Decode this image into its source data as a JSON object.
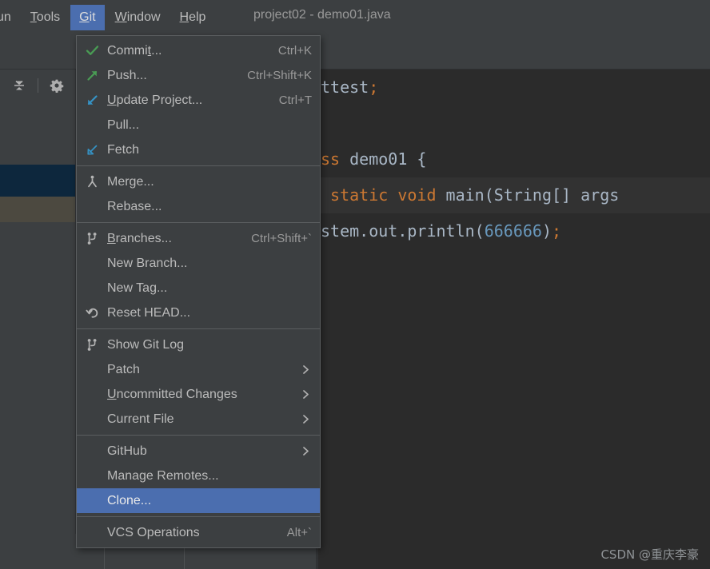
{
  "window": {
    "title": "project02 - demo01.java"
  },
  "menubar": {
    "items": [
      {
        "label": "un",
        "mnemonic": "",
        "active": false
      },
      {
        "label": "Tools",
        "mnemonic": "T",
        "active": false
      },
      {
        "label": "Git",
        "mnemonic": "G",
        "active": true
      },
      {
        "label": "Window",
        "mnemonic": "W",
        "active": false
      },
      {
        "label": "Help",
        "mnemonic": "H",
        "active": false
      }
    ]
  },
  "toolbar": {
    "icons": [
      {
        "name": "collapse-all-icon"
      },
      {
        "name": "gear-icon"
      }
    ]
  },
  "git_menu": {
    "selected_item": "Clone...",
    "highlight_color": "#4b6eaf",
    "background_color": "#3c3f41",
    "groups": [
      {
        "items": [
          {
            "label": "Commit...",
            "accel": "Ctrl+K",
            "icon": "commit-check-icon",
            "mnemonic": "t",
            "arrow": false
          },
          {
            "label": "Push...",
            "accel": "Ctrl+Shift+K",
            "icon": "push-arrow-icon",
            "mnemonic": "",
            "arrow": false
          },
          {
            "label": "Update Project...",
            "accel": "Ctrl+T",
            "icon": "update-arrow-icon",
            "mnemonic": "U",
            "arrow": false
          },
          {
            "label": "Pull...",
            "accel": "",
            "icon": "",
            "mnemonic": "",
            "arrow": false
          },
          {
            "label": "Fetch",
            "accel": "",
            "icon": "fetch-arrow-icon",
            "mnemonic": "",
            "arrow": false
          }
        ]
      },
      {
        "items": [
          {
            "label": "Merge...",
            "accel": "",
            "icon": "merge-icon",
            "mnemonic": "",
            "arrow": false
          },
          {
            "label": "Rebase...",
            "accel": "",
            "icon": "",
            "mnemonic": "",
            "arrow": false
          }
        ]
      },
      {
        "items": [
          {
            "label": "Branches...",
            "accel": "Ctrl+Shift+`",
            "icon": "branch-icon",
            "mnemonic": "B",
            "arrow": false
          },
          {
            "label": "New Branch...",
            "accel": "",
            "icon": "",
            "mnemonic": "",
            "arrow": false
          },
          {
            "label": "New Tag...",
            "accel": "",
            "icon": "",
            "mnemonic": "",
            "arrow": false
          },
          {
            "label": "Reset HEAD...",
            "accel": "",
            "icon": "reset-undo-icon",
            "mnemonic": "",
            "arrow": false
          }
        ]
      },
      {
        "items": [
          {
            "label": "Show Git Log",
            "accel": "",
            "icon": "git-log-branch-icon",
            "mnemonic": "",
            "arrow": false
          },
          {
            "label": "Patch",
            "accel": "",
            "icon": "",
            "mnemonic": "",
            "arrow": true
          },
          {
            "label": "Uncommitted Changes",
            "accel": "",
            "icon": "",
            "mnemonic": "U",
            "arrow": true
          },
          {
            "label": "Current File",
            "accel": "",
            "icon": "",
            "mnemonic": "",
            "arrow": true
          }
        ]
      },
      {
        "items": [
          {
            "label": "GitHub",
            "accel": "",
            "icon": "",
            "mnemonic": "",
            "arrow": true
          },
          {
            "label": "Manage Remotes...",
            "accel": "",
            "icon": "",
            "mnemonic": "",
            "arrow": false
          },
          {
            "label": "Clone...",
            "accel": "",
            "icon": "",
            "mnemonic": "",
            "arrow": false,
            "selected": true
          }
        ]
      },
      {
        "items": [
          {
            "label": "VCS Operations",
            "accel": "Alt+`",
            "icon": "",
            "mnemonic": "",
            "arrow": false
          }
        ]
      }
    ]
  },
  "editor": {
    "background_color": "#2b2b2b",
    "lines": [
      {
        "highlight": false,
        "tokens": [
          {
            "t": "ttest",
            "c": "pn"
          },
          {
            "t": ";",
            "c": "kw"
          }
        ]
      },
      {
        "highlight": false,
        "tokens": []
      },
      {
        "highlight": false,
        "tokens": [
          {
            "t": "ss ",
            "c": "kw"
          },
          {
            "t": "demo01 {",
            "c": "pn"
          }
        ]
      },
      {
        "highlight": true,
        "tokens": [
          {
            "t": " static void ",
            "c": "kw"
          },
          {
            "t": "main(String[] args",
            "c": "pn"
          }
        ]
      },
      {
        "highlight": false,
        "tokens": [
          {
            "t": "stem.out.println(",
            "c": "pn"
          },
          {
            "t": "666666",
            "c": "num"
          },
          {
            "t": ")",
            "c": "pn"
          },
          {
            "t": ";",
            "c": "kw"
          }
        ]
      }
    ]
  },
  "watermark": {
    "text": "CSDN @重庆李豪"
  }
}
